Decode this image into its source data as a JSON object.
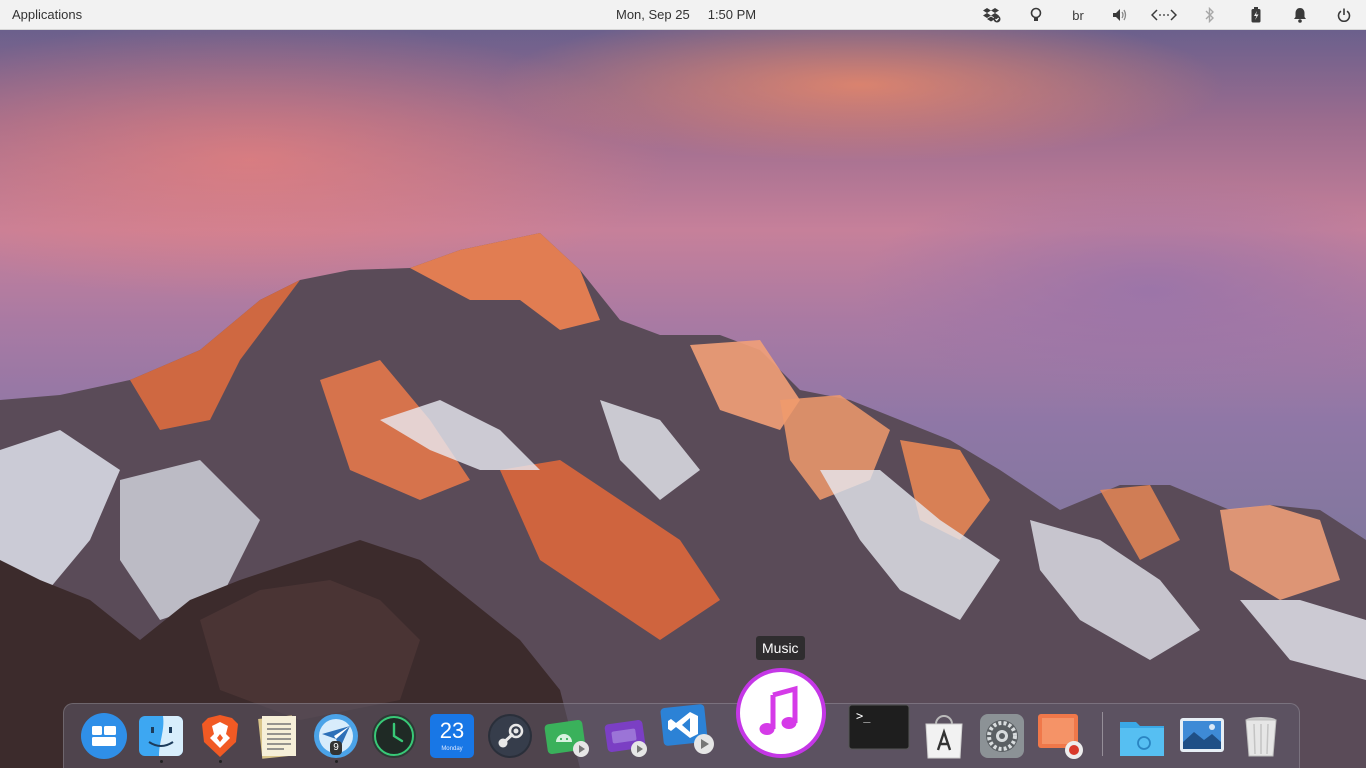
{
  "top_panel": {
    "applications_label": "Applications",
    "date": "Mon, Sep 25",
    "time": "1:50 PM",
    "keyboard_layout": "br",
    "indicators": [
      "dropbox-icon",
      "bulb-icon",
      "keyboard-layout",
      "volume-icon",
      "network-icon",
      "bluetooth-icon",
      "battery-icon",
      "notifications-icon",
      "power-icon"
    ]
  },
  "dock": {
    "tooltip": "Music",
    "apps": [
      {
        "name": "Multitasking View",
        "icon": "multitasking-icon"
      },
      {
        "name": "Files",
        "icon": "finder-icon"
      },
      {
        "name": "Brave",
        "icon": "brave-icon"
      },
      {
        "name": "Text Editor",
        "icon": "notes-icon"
      },
      {
        "name": "Mail",
        "icon": "mail-icon",
        "badge": "9"
      },
      {
        "name": "Clock",
        "icon": "clock-icon"
      },
      {
        "name": "Calendar",
        "icon": "calendar-icon",
        "calendar_day": "23",
        "calendar_weekday": "Monday"
      },
      {
        "name": "Steam",
        "icon": "steam-icon"
      },
      {
        "name": "Android Studio",
        "icon": "android-icon"
      },
      {
        "name": "Media Player",
        "icon": "media-icon"
      },
      {
        "name": "Visual Studio Code",
        "icon": "vscode-icon"
      },
      {
        "name": "Music",
        "icon": "music-icon"
      },
      {
        "name": "Terminal",
        "icon": "terminal-icon",
        "prompt": ">_"
      },
      {
        "name": "App Store",
        "icon": "appstore-icon"
      },
      {
        "name": "System Settings",
        "icon": "settings-icon"
      },
      {
        "name": "Screenshot",
        "icon": "screenshot-icon"
      },
      {
        "name": "Home Folder",
        "icon": "folder-icon"
      },
      {
        "name": "Photos",
        "icon": "photos-icon"
      },
      {
        "name": "Trash",
        "icon": "trash-icon"
      }
    ]
  },
  "colors": {
    "panel_bg": "#f2f2f2",
    "dock_bg": "rgba(95,90,105,0.55)",
    "music_accent": "#e040fb"
  }
}
